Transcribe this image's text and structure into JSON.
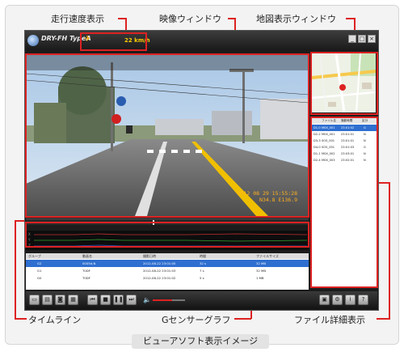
{
  "annotations": {
    "speed": "走行速度表示",
    "video": "映像ウィンドウ",
    "map": "地図表示ウィンドウ",
    "timeline": "タイムライン",
    "gsensor": "Gセンサーグラフ",
    "filedetail": "ファイル詳細表示"
  },
  "caption": "ビューアソフト表示イメージ",
  "app": {
    "title": "DRY-FH TypeA",
    "speed_value": "22 km/h",
    "window_buttons": [
      "_",
      "□",
      "×"
    ],
    "video_timestamp": "2012 08 29 15:55:28",
    "video_position": "N34.8 E136.9"
  },
  "file_panel": {
    "headers": [
      "ファイル名",
      "撮影時間",
      "区分"
    ],
    "rows": [
      {
        "n": "D1-0",
        "name": "M0X_001",
        "time": "23:01:02",
        "t": "G"
      },
      {
        "n": "D2-2",
        "name": "M0X_001",
        "time": "23:01:01",
        "t": "N"
      },
      {
        "n": "D3-3",
        "name": "SOS_001",
        "time": "23:01:01",
        "t": "N"
      },
      {
        "n": "D4-0",
        "name": "SOS_001",
        "time": "23:01:03",
        "t": "G"
      },
      {
        "n": "D1-1",
        "name": "M0X_002",
        "time": "23:03:01",
        "t": "N"
      },
      {
        "n": "D2-4",
        "name": "M0X_003",
        "time": "23:02:01",
        "t": "N"
      }
    ]
  },
  "gsensor_labels": [
    "X",
    "Y",
    "Z"
  ],
  "file_table": {
    "headers": [
      "グループ",
      "動画名",
      "撮影日時",
      "時間",
      "ファイルサイズ"
    ],
    "rows": [
      {
        "group": "G2",
        "name": "0005d-N",
        "date": "2012-08-22 23:01:05",
        "dur": "32 s",
        "size": "32 MB"
      },
      {
        "group": "G1",
        "name": "T0DF",
        "date": "2012-08-22 23:01:03",
        "dur": "7 s",
        "size": "32 MB"
      },
      {
        "group": "G0",
        "name": "T0DF",
        "date": "2012-08-22 23:01:02",
        "dur": "5 s",
        "size": "1 MB"
      }
    ]
  },
  "controls": {
    "buttons": [
      "folder",
      "save",
      "camera",
      "print",
      "prev",
      "stop",
      "play",
      "next"
    ],
    "volume_icon": "speaker-icon"
  }
}
